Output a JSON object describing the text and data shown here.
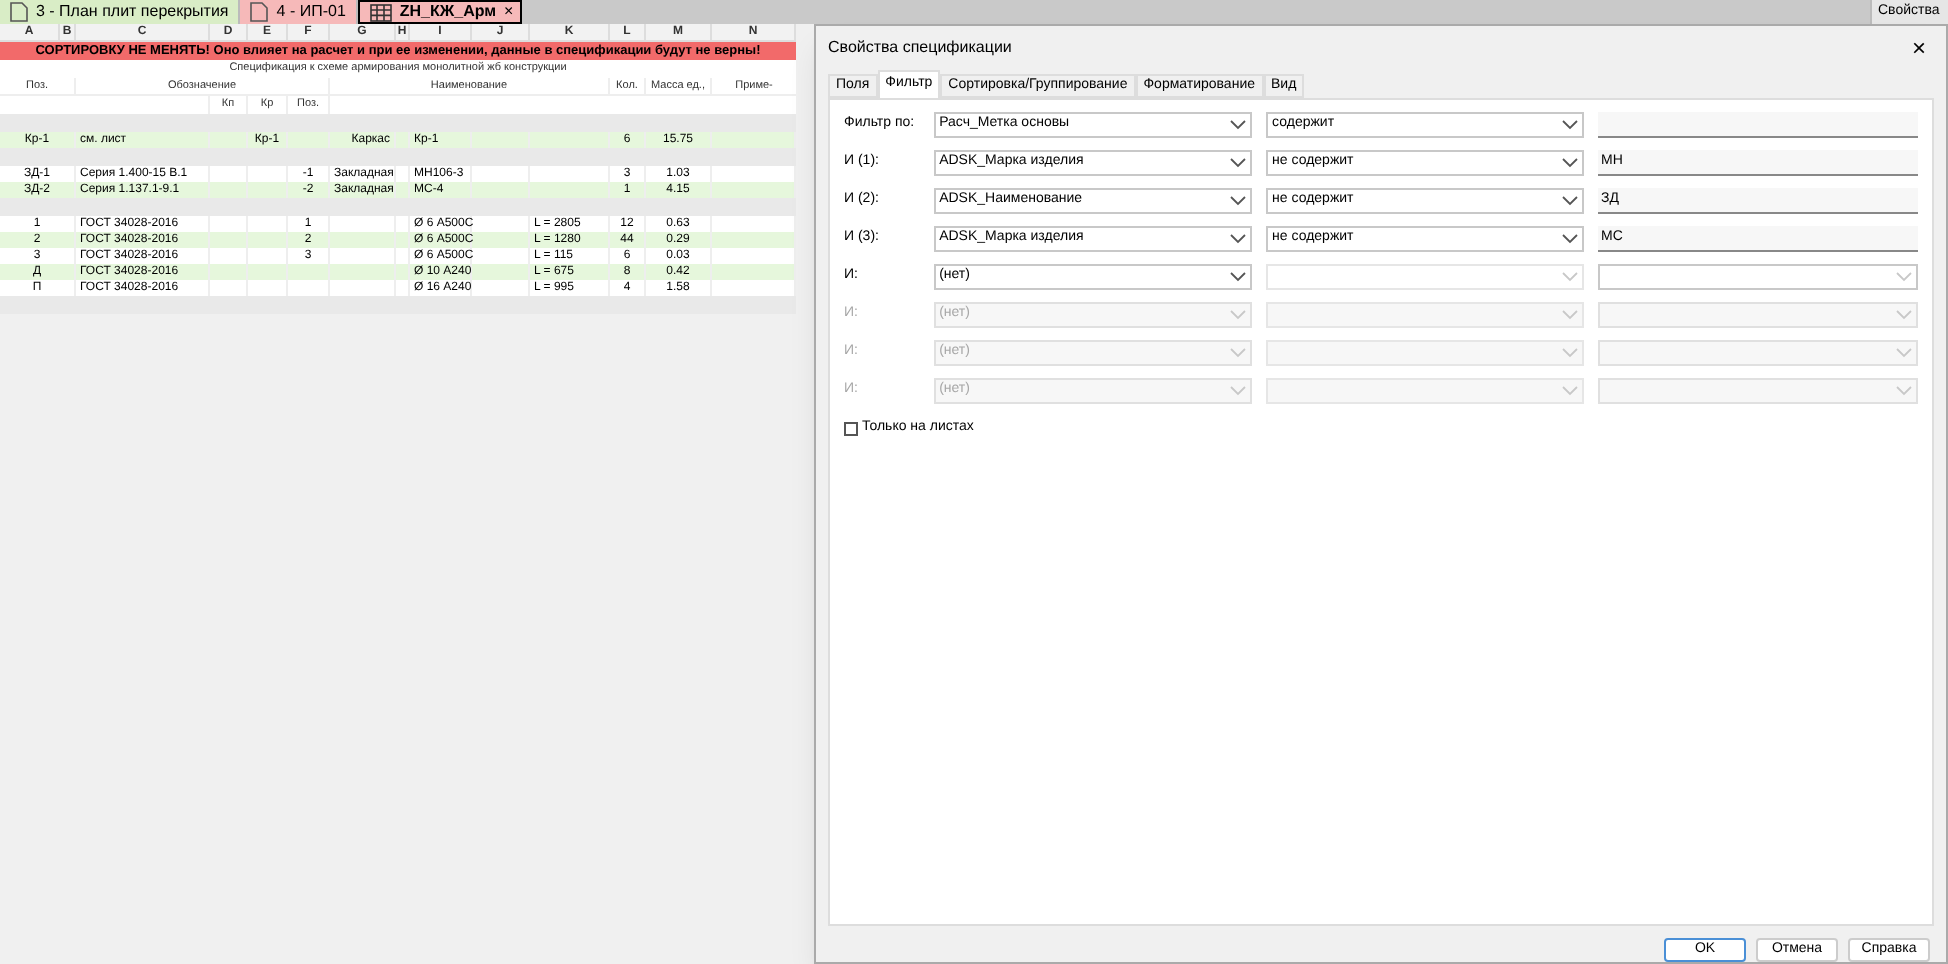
{
  "doc_tabs": [
    {
      "label": "3 - План плит перекрытия",
      "kind": "plan",
      "selected": false
    },
    {
      "label": "4 - ИП-01",
      "kind": "sheet",
      "selected": false
    },
    {
      "label": "ZH_КЖ_Арм",
      "kind": "schedule",
      "selected": true,
      "close": "×"
    }
  ],
  "side_panel": {
    "title": "Свойства"
  },
  "sheet": {
    "columns": [
      "A",
      "B",
      "C",
      "D",
      "E",
      "F",
      "G",
      "H",
      "I",
      "J",
      "K",
      "L",
      "M",
      "N"
    ],
    "banner": "СОРТИРОВКУ НЕ МЕНЯТЬ! Оно влияет на расчет и при ее изменении, данные в спецификации будут не верны!",
    "title": "Спецификация к схеме армирования монолитной жб конструкции",
    "header": {
      "pos": "Поз.",
      "designation": "Обозначение",
      "name": "Наименование",
      "qty": "Кол.",
      "mass": "Масса ед.,",
      "note": "Приме-"
    },
    "subheader": [
      "Кп",
      "Кр",
      "Поз."
    ],
    "rows": [
      {
        "kind": "blank"
      },
      {
        "kind": "data",
        "shaded": true,
        "cells": [
          "Кр-1",
          "см. лист",
          "",
          "Кр-1",
          "",
          "Каркас",
          "",
          "Кр-1",
          "",
          "",
          "6",
          "15.75",
          ""
        ]
      },
      {
        "kind": "blank"
      },
      {
        "kind": "data",
        "shaded": false,
        "cells": [
          "ЗД-1",
          "Серия 1.400-15 В.1",
          "",
          "",
          "-1",
          "Закладная",
          "",
          "МН106-3",
          "",
          "",
          "3",
          "1.03",
          ""
        ]
      },
      {
        "kind": "data",
        "shaded": true,
        "cells": [
          "ЗД-2",
          "Серия 1.137.1-9.1",
          "",
          "",
          "-2",
          "Закладная",
          "",
          "МС-4",
          "",
          "",
          "1",
          "4.15",
          ""
        ]
      },
      {
        "kind": "blank"
      },
      {
        "kind": "data",
        "shaded": false,
        "cells": [
          "1",
          "ГОСТ 34028-2016",
          "",
          "",
          "1",
          "",
          "",
          "Ø 6 А500С",
          "",
          "L = 2805",
          "12",
          "0.63",
          ""
        ]
      },
      {
        "kind": "data",
        "shaded": true,
        "cells": [
          "2",
          "ГОСТ 34028-2016",
          "",
          "",
          "2",
          "",
          "",
          "Ø 6 А500С",
          "",
          "L = 1280",
          "44",
          "0.29",
          ""
        ]
      },
      {
        "kind": "data",
        "shaded": false,
        "cells": [
          "3",
          "ГОСТ 34028-2016",
          "",
          "",
          "3",
          "",
          "",
          "Ø 6 А500С",
          "",
          "L = 115",
          "6",
          "0.03",
          ""
        ]
      },
      {
        "kind": "data",
        "shaded": true,
        "cells": [
          "Д",
          "ГОСТ 34028-2016",
          "",
          "",
          "",
          "",
          "",
          "Ø 10 А240",
          "",
          "L = 675",
          "8",
          "0.42",
          ""
        ]
      },
      {
        "kind": "data",
        "shaded": false,
        "cells": [
          "П",
          "ГОСТ 34028-2016",
          "",
          "",
          "",
          "",
          "",
          "Ø 16 А240",
          "",
          "L = 995",
          "4",
          "1.58",
          ""
        ]
      }
    ]
  },
  "dialog": {
    "title": "Свойства спецификации",
    "close": "×",
    "tabs": [
      {
        "label": "Поля",
        "selected": false
      },
      {
        "label": "Фильтр",
        "selected": true
      },
      {
        "label": "Сортировка/Группирование",
        "selected": false
      },
      {
        "label": "Форматирование",
        "selected": false
      },
      {
        "label": "Вид",
        "selected": false
      }
    ],
    "filters": [
      {
        "label": "Фильтр по:",
        "field": "Расч_Метка основы",
        "condition": "содержит",
        "kind": "text",
        "disabled": false
      },
      {
        "label": "И (1):",
        "field": "ADSK_Марка изделия",
        "condition": "не содержит",
        "kind": "text",
        "value": "МН",
        "disabled": false
      },
      {
        "label": "И (2):",
        "field": "ADSK_Наименование",
        "condition": "не содержит",
        "kind": "text",
        "value": "ЗД",
        "disabled": false
      },
      {
        "label": "И (3):",
        "field": "ADSK_Марка изделия",
        "condition": "не содержит",
        "kind": "text",
        "value": "МС",
        "disabled": false
      },
      {
        "label": "И:",
        "field": "(нет)",
        "kind": "dropdown",
        "disabled": false
      },
      {
        "label": "И:",
        "field": "(нет)",
        "kind": "dropdown",
        "disabled": true
      },
      {
        "label": "И:",
        "field": "(нет)",
        "kind": "dropdown",
        "disabled": true
      },
      {
        "label": "И:",
        "field": "(нет)",
        "kind": "dropdown",
        "disabled": true
      }
    ],
    "sheets_only": {
      "label": "Только на листах",
      "checked": false
    },
    "buttons": [
      {
        "label": "OK",
        "primary": true
      },
      {
        "label": "Отмена",
        "primary": false
      },
      {
        "label": "Справка",
        "primary": false
      }
    ]
  }
}
